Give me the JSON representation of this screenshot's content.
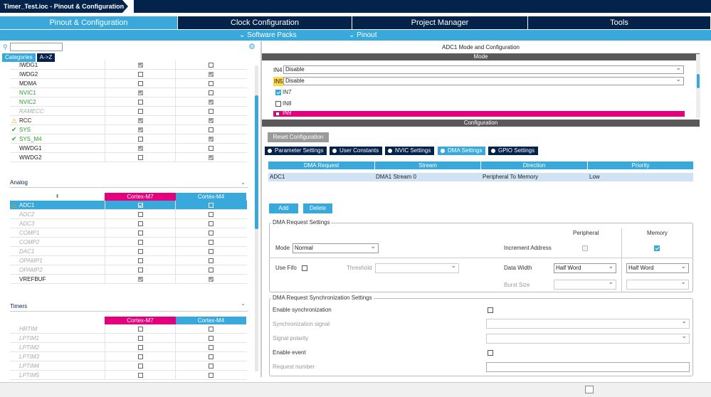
{
  "window": {
    "title": "Timer_Test.ioc - Pinout & Configuration"
  },
  "tabs": [
    "Pinout & Configuration",
    "Clock Configuration",
    "Project Manager",
    "Tools"
  ],
  "subnav": {
    "software_packs": "Software Packs",
    "pinout": "Pinout"
  },
  "left": {
    "search_placeholder": "",
    "cat_tabs": [
      "Categories",
      "A->Z"
    ],
    "system_rows": [
      {
        "name": "IWDG1",
        "status": "",
        "m7": true,
        "m4": false
      },
      {
        "name": "IWDG2",
        "status": "",
        "m7": false,
        "m4": true
      },
      {
        "name": "MDMA",
        "status": "",
        "m7": false,
        "m4": false
      },
      {
        "name": "NVIC1",
        "status": "green",
        "m7": true,
        "m4": false
      },
      {
        "name": "NVIC2",
        "status": "green",
        "m7": false,
        "m4": true
      },
      {
        "name": "RAMECC",
        "status": "disabled",
        "m7": "empty",
        "m4": "empty"
      },
      {
        "name": "RCC",
        "status": "warn",
        "m7": true,
        "m4": true
      },
      {
        "name": "SYS",
        "status": "ok",
        "m7": true,
        "m4": false
      },
      {
        "name": "SYS_M4",
        "status": "ok",
        "m7": false,
        "m4": true
      },
      {
        "name": "WWDG1",
        "status": "",
        "m7": true,
        "m4": false
      },
      {
        "name": "WWDG2",
        "status": "",
        "m7": false,
        "m4": true
      }
    ],
    "analog": {
      "title": "Analog",
      "headers": [
        "Cortex-M7",
        "Cortex-M4"
      ],
      "rows": [
        {
          "name": "ADC1",
          "status": "warn",
          "m7": true,
          "m4": false
        },
        {
          "name": "ADC2",
          "status": "disabled"
        },
        {
          "name": "ADC3",
          "status": "disabled"
        },
        {
          "name": "COMP1",
          "status": "disabled"
        },
        {
          "name": "COMP2",
          "status": "disabled"
        },
        {
          "name": "DAC1",
          "status": "disabled"
        },
        {
          "name": "OPAMP1",
          "status": "disabled"
        },
        {
          "name": "OPAMP2",
          "status": "disabled"
        },
        {
          "name": "VREFBUF",
          "status": "",
          "m7": true,
          "m4": true
        }
      ]
    },
    "timers": {
      "title": "Timers",
      "headers": [
        "Cortex-M7",
        "Cortex-M4"
      ],
      "rows": [
        "HRTIM",
        "LPTIM1",
        "LPTIM2",
        "LPTIM3",
        "LPTIM4",
        "LPTIM5"
      ]
    }
  },
  "right": {
    "title": "ADC1 Mode and Configuration",
    "mode_band": "Mode",
    "mode_rows": [
      {
        "label": "IN4",
        "value": "Disable"
      },
      {
        "label": "IN5",
        "value": "Disable"
      }
    ],
    "mode_checks": [
      {
        "label": "IN7",
        "checked": true
      },
      {
        "label": "IN8",
        "checked": false
      },
      {
        "label": "IN9",
        "checked": false
      }
    ],
    "config_band": "Configuration",
    "reset_button": "Reset Configuration",
    "config_tabs": [
      "Parameter Settings",
      "User Constants",
      "NVIC Settings",
      "DMA Settings",
      "GPIO Settings"
    ],
    "dma_table": {
      "headers": [
        "DMA Request",
        "Stream",
        "Direction",
        "Priority"
      ],
      "rows": [
        [
          "ADC1",
          "DMA1 Stream 0",
          "Peripheral To Memory",
          "Low"
        ]
      ]
    },
    "add_button": "Add",
    "delete_button": "Delete",
    "dma_request_settings": {
      "legend": "DMA Request Settings",
      "peripheral": "Peripheral",
      "memory": "Memory",
      "mode_label": "Mode",
      "mode_value": "Normal",
      "increment_address": "Increment Address",
      "use_fifo": "Use Fifo",
      "threshold": "Threshold",
      "data_width": "Data Width",
      "data_width_periph": "Half Word",
      "data_width_mem": "Half Word",
      "burst_size": "Burst Size"
    },
    "sync_settings": {
      "legend": "DMA Request Synchronization Settings",
      "enable_sync": "Enable synchronization",
      "sync_signal": "Synchronization signal",
      "signal_polarity": "Signal polarity",
      "enable_event": "Enable event",
      "request_number": "Request number"
    }
  },
  "colors": {
    "navy": "#03234b",
    "accent": "#39a9dc",
    "m7": "#e4007c"
  }
}
